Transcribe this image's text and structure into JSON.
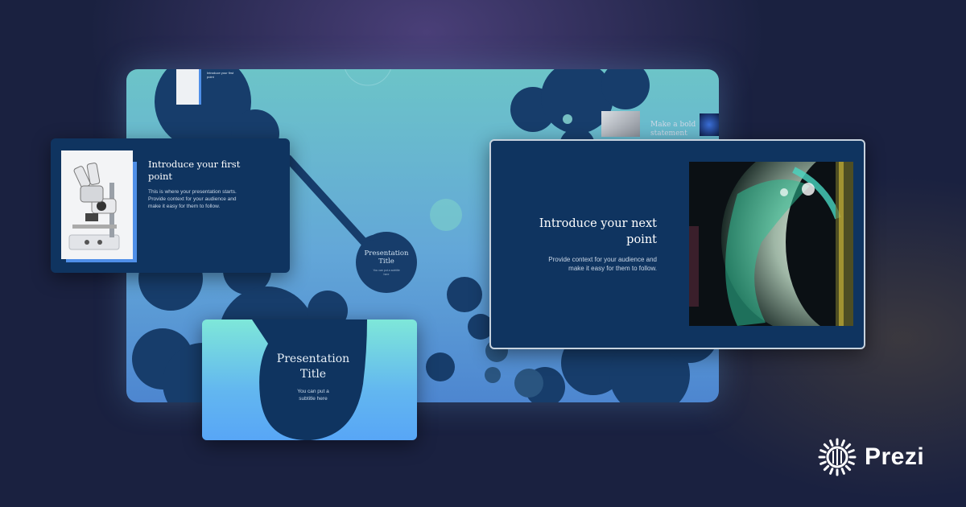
{
  "canvas": {
    "mini_heading_1": "Introduce your first point",
    "mini_heading_2": "Make a bold statement",
    "center_title": "Presentation Title",
    "center_subtitle": "You can put a subtitle here"
  },
  "card_first_point": {
    "heading": "Introduce your first point",
    "body": "This is where your presentation starts. Provide context for your audience and make it easy for them to follow."
  },
  "card_next_point": {
    "heading": "Introduce your next point",
    "body": "Provide context for your audience and make it easy for them to follow."
  },
  "card_title": {
    "title": "Presentation Title",
    "subtitle": "You can put a subtitle here"
  },
  "brand": {
    "name": "Prezi"
  },
  "colors": {
    "card_bg": "#0f3460",
    "accent": "#4f8fe8"
  }
}
